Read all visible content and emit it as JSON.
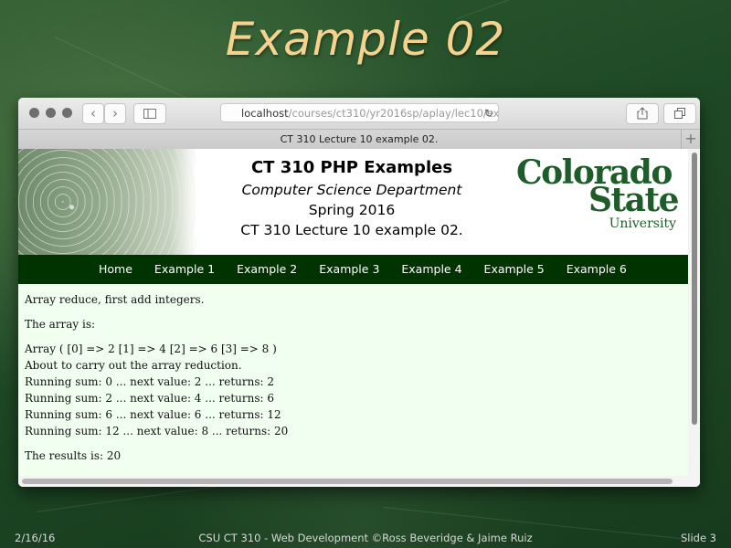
{
  "slide": {
    "title": "Example 02",
    "footer_date": "2/16/16",
    "footer_center": "CSU CT 310 - Web Development ©Ross Beveridge & Jaime Ruiz",
    "footer_slide": "Slide 3"
  },
  "browser": {
    "nav_back_icon": "chevron-left-icon",
    "nav_forward_icon": "chevron-right-icon",
    "sidebar_icon": "sidebar-icon",
    "url_host": "localhost",
    "url_path": "/courses/ct310/yr2016sp/aplay/lec10/",
    "url_tail": "ex",
    "reload_icon": "reload-icon",
    "share_icon": "share-icon",
    "tabs_icon": "tabs-icon",
    "tab_title": "CT 310 Lecture 10 example 02.",
    "new_tab_icon": "plus-icon"
  },
  "page": {
    "heading": "CT 310 PHP Examples",
    "department": "Computer Science Department",
    "term": "Spring 2016",
    "lecture": "CT 310 Lecture 10 example 02.",
    "logo_line1": "Colorado",
    "logo_line2": "State",
    "logo_line3": "University",
    "nav": [
      "Home",
      "Example 1",
      "Example 2",
      "Example 3",
      "Example 4",
      "Example 5",
      "Example 6"
    ],
    "intro": "Array reduce, first add integers.",
    "array_label": "The array is:",
    "array_dump": "Array ( [0] => 2 [1] => 4 [2] => 6 [3] => 8 )",
    "about": "About to carry out the array reduction.",
    "steps": [
      "Running sum: 0 ... next value: 2 ... returns: 2",
      "Running sum: 2 ... next value: 4 ... returns: 6",
      "Running sum: 6 ... next value: 6 ... returns: 12",
      "Running sum: 12 ... next value: 8 ... returns: 20"
    ],
    "result": "The results is: 20"
  },
  "colors": {
    "title": "#f5d28e",
    "nav_bg": "#003300",
    "page_bg": "#f0fff0",
    "logo_green": "#1e5c2a"
  }
}
